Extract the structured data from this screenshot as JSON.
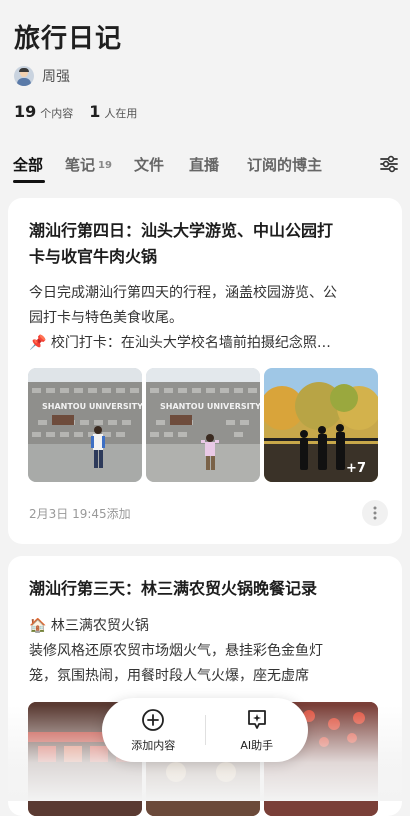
{
  "header": {
    "title": "旅行日记",
    "author": "周强",
    "stats": [
      {
        "value": "19",
        "label": "个内容"
      },
      {
        "value": "1",
        "label": "人在用"
      }
    ]
  },
  "tabs": [
    {
      "label": "全部",
      "count": "",
      "active": true
    },
    {
      "label": "笔记",
      "count": "19",
      "active": false
    },
    {
      "label": "文件",
      "count": "",
      "active": false
    },
    {
      "label": "直播",
      "count": "",
      "active": false
    },
    {
      "label": "订阅的博主",
      "count": "",
      "active": false
    }
  ],
  "cards": [
    {
      "title_line1": "潮汕行第四日：汕头大学游览、中山公园打",
      "title_line2": "卡与收官牛肉火锅",
      "desc_line1": "今日完成潮汕行第四天的行程，涵盖校园游览、公",
      "desc_line2": "园打卡与特色美食收尾。",
      "desc_line3": "📌 校门打卡：在汕头大学校名墙前拍摄纪念照…",
      "photo_more": "+7",
      "sign_text": "SHANTOU UNIVERSITY",
      "meta": "2月3日 19:45添加"
    },
    {
      "title": "潮汕行第三天：林三满农贸火锅晚餐记录",
      "desc_line1": "🏠 林三满农贸火锅",
      "desc_line2": "装修风格还原农贸市场烟火气，悬挂彩色金鱼灯",
      "desc_line3": "笼，氛围热闹，用餐时段人气火爆，座无虚席"
    }
  ],
  "fab": {
    "add_label": "添加内容",
    "ai_label": "AI助手"
  },
  "colors": {
    "background": "#f3f3f3",
    "card": "#ffffff",
    "text_primary": "#1f1f1f",
    "text_meta": "#999999"
  }
}
